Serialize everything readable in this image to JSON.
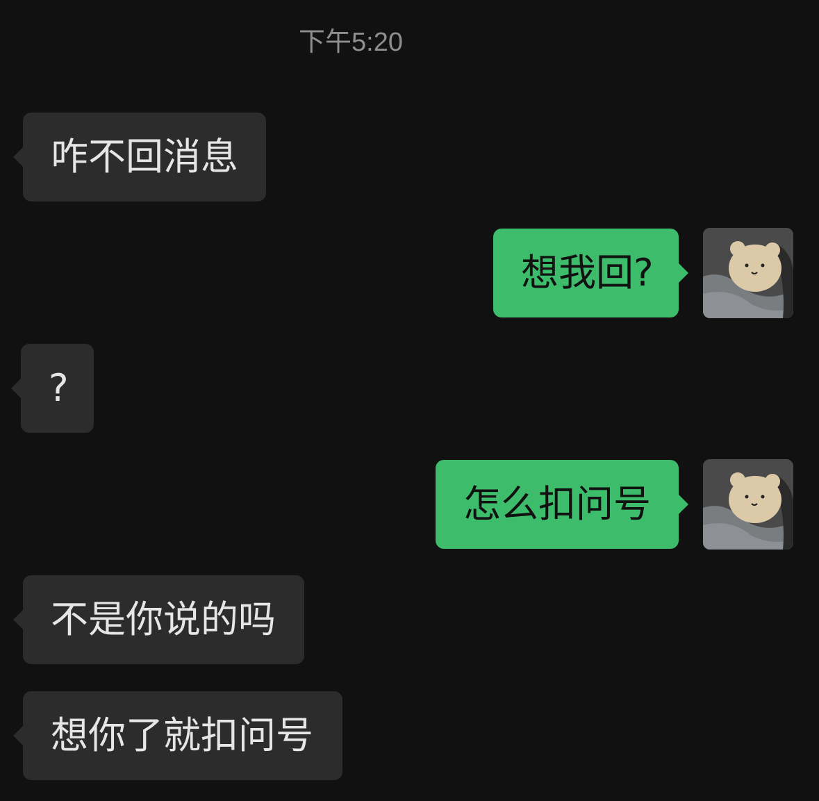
{
  "timestamp": "下午5:20",
  "messages": [
    {
      "side": "in",
      "text": "咋不回消息"
    },
    {
      "side": "out",
      "text": "想我回?"
    },
    {
      "side": "in",
      "text": "?"
    },
    {
      "side": "out",
      "text": "怎么扣问号"
    },
    {
      "side": "in",
      "text": "不是你说的吗"
    },
    {
      "side": "in",
      "text": "想你了就扣问号"
    }
  ],
  "colors": {
    "background": "#111111",
    "incoming_bubble": "#2c2c2c",
    "outgoing_bubble": "#3dbd6c",
    "timestamp_text": "#8e8e8e"
  },
  "avatar_icon": "bear-avatar-icon"
}
